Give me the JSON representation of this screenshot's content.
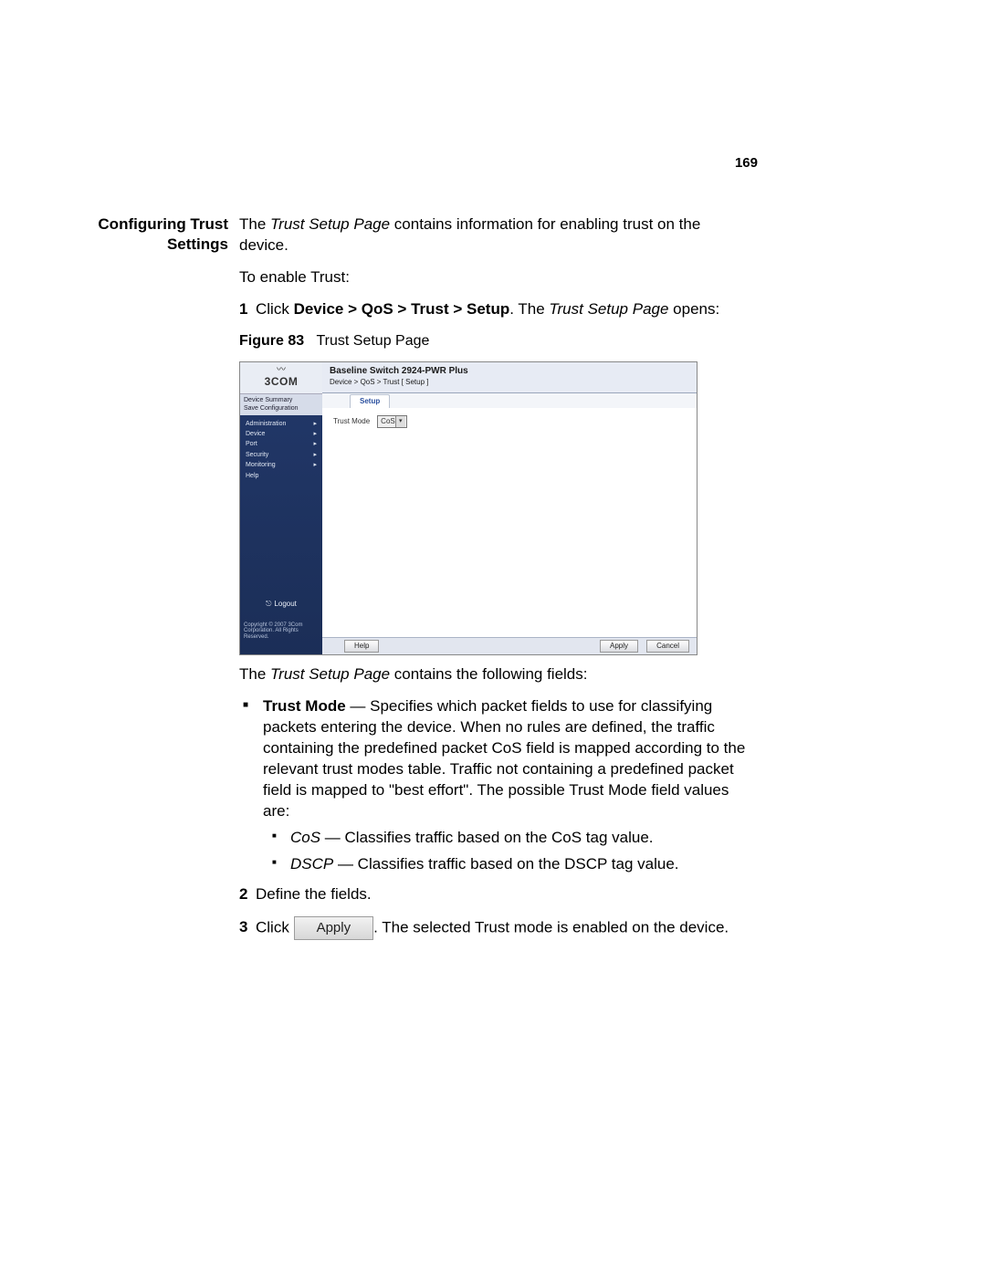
{
  "page_number": "169",
  "section_heading": "Configuring Trust Settings",
  "intro": {
    "line1_pre": "The ",
    "line1_em": "Trust Setup Page",
    "line1_post": " contains information for enabling trust on the device.",
    "line2": "To enable Trust:"
  },
  "step1": {
    "num": "1",
    "pre": "Click ",
    "bold": "Device > QoS > Trust > Setup",
    "post_pre": ". The ",
    "post_em": "Trust Setup Page",
    "post_tail": " opens:"
  },
  "figure": {
    "label_bold": "Figure 83",
    "label_rest": "Trust Setup Page"
  },
  "shot": {
    "logo_text": "3COM",
    "side_top1": "Device Summary",
    "side_top2": "Save Configuration",
    "menu": {
      "admin": "Administration",
      "device": "Device",
      "port": "Port",
      "security": "Security",
      "monitoring": "Monitoring",
      "help": "Help"
    },
    "logout": "Logout",
    "copyright": "Copyright © 2007\n3Com Corporation.\nAll Rights Reserved.",
    "header_title": "Baseline Switch 2924-PWR Plus",
    "header_crumb": "Device > QoS > Trust [ Setup ]",
    "tab": "Setup",
    "field_label": "Trust Mode",
    "field_value": "CoS",
    "btn_help": "Help",
    "btn_apply": "Apply",
    "btn_cancel": "Cancel"
  },
  "after_fig": {
    "pre": "The ",
    "em": "Trust Setup Page",
    "post": " contains the following fields:"
  },
  "trust_mode": {
    "name": "Trust Mode",
    "desc": " — Specifies which packet fields to use for classifying packets entering the device. When no rules are defined, the traffic containing the predefined packet CoS field is mapped according to the relevant trust modes table. Traffic not containing a predefined packet field is mapped to \"best effort\". The possible Trust Mode field values are:",
    "cos_name": "CoS",
    "cos_desc": " — Classifies traffic based on the CoS tag value.",
    "dscp_name": "DSCP",
    "dscp_desc": " — Classifies traffic based on the DSCP tag value."
  },
  "step2": {
    "num": "2",
    "text": "Define the fields."
  },
  "step3": {
    "num": "3",
    "pre": "Click ",
    "btn": "Apply",
    "post": ". The selected Trust mode is enabled on the device."
  }
}
